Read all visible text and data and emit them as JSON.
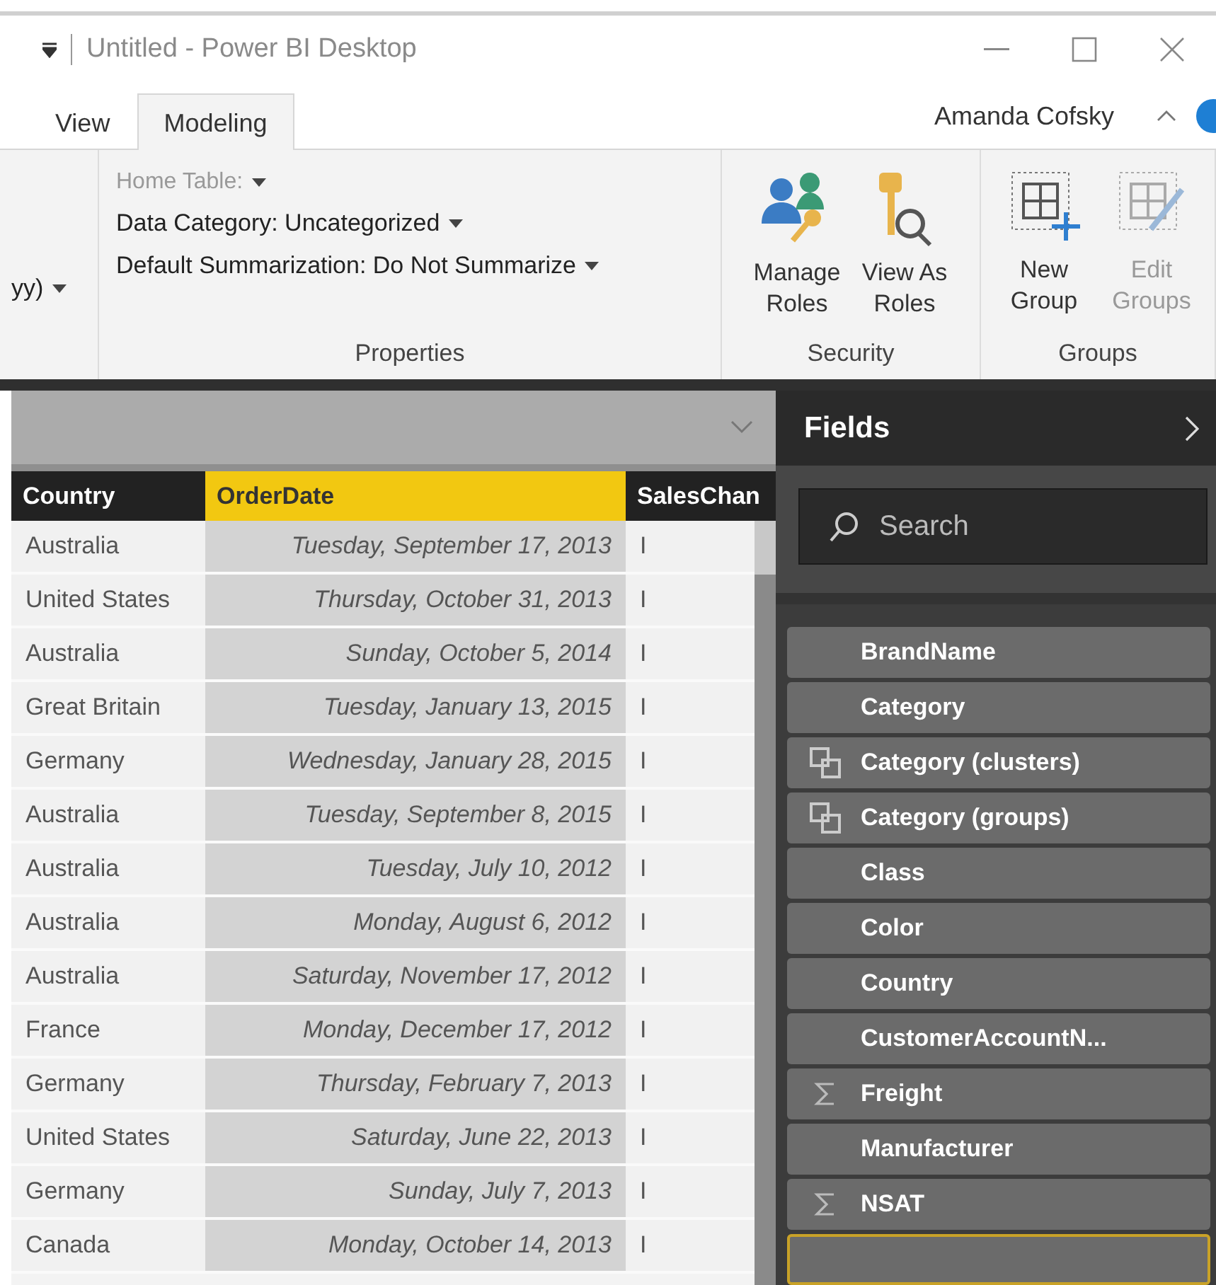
{
  "window": {
    "title": "Untitled - Power BI Desktop"
  },
  "tabs": [
    {
      "label": "View",
      "selected": false
    },
    {
      "label": "Modeling",
      "selected": true
    }
  ],
  "user": "Amanda Cofsky",
  "ribbon": {
    "cut_text": "yy)",
    "properties": {
      "items": [
        {
          "label": "Home Table:",
          "disabled": true
        },
        {
          "label": "Data Category: Uncategorized",
          "disabled": false
        },
        {
          "label": "Default Summarization: Do Not Summarize",
          "disabled": false
        }
      ],
      "label": "Properties"
    },
    "security": {
      "buttons": [
        {
          "label": "Manage Roles",
          "disabled": false
        },
        {
          "label": "View As Roles",
          "disabled": false
        }
      ],
      "label": "Security"
    },
    "groups": {
      "buttons": [
        {
          "label": "New Group",
          "disabled": false
        },
        {
          "label": "Edit Groups",
          "disabled": true
        }
      ],
      "label": "Groups"
    }
  },
  "table": {
    "columns": [
      {
        "label": "Country",
        "selected": false
      },
      {
        "label": "OrderDate",
        "selected": true
      },
      {
        "label": "SalesChan",
        "selected": false
      }
    ],
    "rows": [
      [
        "Australia",
        "Tuesday, September 17, 2013",
        "I"
      ],
      [
        "United States",
        "Thursday, October 31, 2013",
        "I"
      ],
      [
        "Australia",
        "Sunday, October 5, 2014",
        "I"
      ],
      [
        "Great Britain",
        "Tuesday, January 13, 2015",
        "I"
      ],
      [
        "Germany",
        "Wednesday, January 28, 2015",
        "I"
      ],
      [
        "Australia",
        "Tuesday, September 8, 2015",
        "I"
      ],
      [
        "Australia",
        "Tuesday, July 10, 2012",
        "I"
      ],
      [
        "Australia",
        "Monday, August 6, 2012",
        "I"
      ],
      [
        "Australia",
        "Saturday, November 17, 2012",
        "I"
      ],
      [
        "France",
        "Monday, December 17, 2012",
        "I"
      ],
      [
        "Germany",
        "Thursday, February 7, 2013",
        "I"
      ],
      [
        "United States",
        "Saturday, June 22, 2013",
        "I"
      ],
      [
        "Germany",
        "Sunday, July 7, 2013",
        "I"
      ],
      [
        "Canada",
        "Monday, October 14, 2013",
        "I"
      ]
    ]
  },
  "fields": {
    "title": "Fields",
    "search": {
      "placeholder": "Search"
    },
    "items": [
      {
        "label": "BrandName",
        "kind": "plain",
        "selected": false
      },
      {
        "label": "Category",
        "kind": "plain",
        "selected": false
      },
      {
        "label": "Category (clusters)",
        "kind": "group",
        "selected": false
      },
      {
        "label": "Category (groups)",
        "kind": "group",
        "selected": false
      },
      {
        "label": "Class",
        "kind": "plain",
        "selected": false
      },
      {
        "label": "Color",
        "kind": "plain",
        "selected": false
      },
      {
        "label": "Country",
        "kind": "plain",
        "selected": false
      },
      {
        "label": "CustomerAccountN...",
        "kind": "plain",
        "selected": false
      },
      {
        "label": "Freight",
        "kind": "measure",
        "selected": false
      },
      {
        "label": "Manufacturer",
        "kind": "plain",
        "selected": false
      },
      {
        "label": "NSAT",
        "kind": "measure",
        "selected": false
      },
      {
        "kind": "plain",
        "selected": true
      }
    ]
  }
}
